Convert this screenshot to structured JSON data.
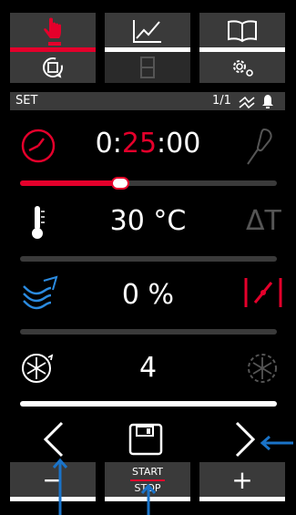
{
  "header": {
    "set_label": "SET",
    "page_indicator": "1/1"
  },
  "timer": {
    "hours": "0",
    "minutes": "25",
    "seconds": "00",
    "progress_fraction": 0.39
  },
  "temperature": {
    "value": "30 °C",
    "delta_label": "ΔT"
  },
  "humidity": {
    "value": "0 %"
  },
  "fan": {
    "value": "4"
  },
  "bottom": {
    "minus_label": "−",
    "start_label": "START",
    "stop_label": "STOP",
    "plus_label": "+"
  },
  "colors": {
    "accent_red": "#e4002b",
    "tile_gray": "#3a3a3a",
    "annotation_blue": "#1a73c8"
  }
}
